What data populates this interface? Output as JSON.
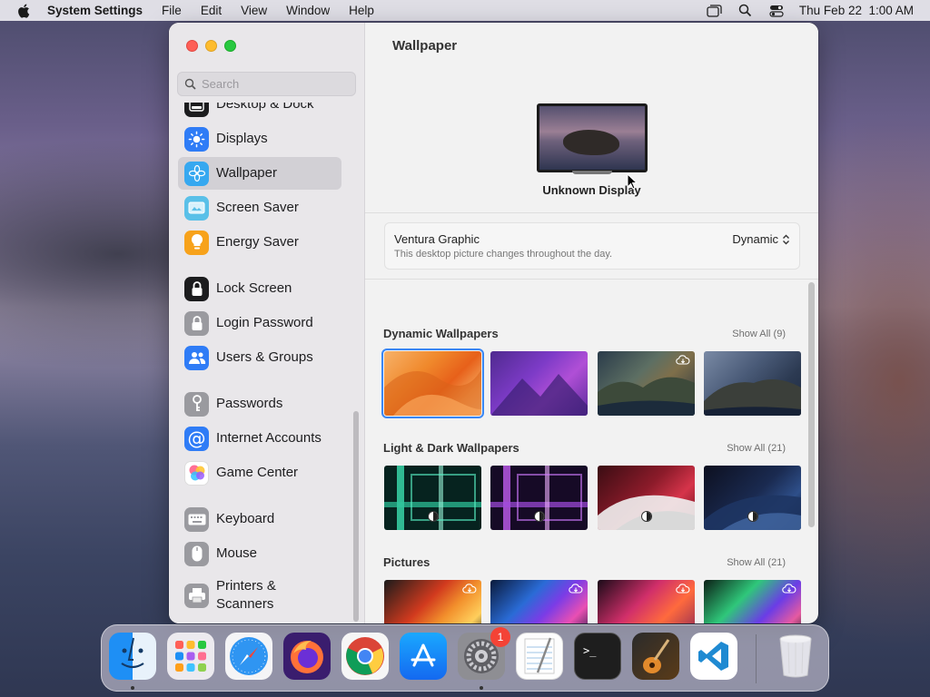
{
  "menubar": {
    "app_name": "System Settings",
    "items": [
      "File",
      "Edit",
      "View",
      "Window",
      "Help"
    ],
    "datetime": "Thu Feb 22  1:00 AM"
  },
  "sidebar": {
    "search_placeholder": "Search",
    "items": [
      {
        "label": "Desktop & Dock",
        "icon": "dock-icon",
        "color": "#1c1c1e"
      },
      {
        "label": "Displays",
        "icon": "sun-icon",
        "color": "#2f7cf6"
      },
      {
        "label": "Wallpaper",
        "icon": "flower-icon",
        "color": "#36a8f0",
        "active": true
      },
      {
        "label": "Screen Saver",
        "icon": "screen-saver-icon",
        "color": "#5ac0e8"
      },
      {
        "label": "Energy Saver",
        "icon": "bulb-icon",
        "color": "#f7a21b"
      },
      {
        "label": "Lock Screen",
        "icon": "lock-icon",
        "color": "#1c1c1e"
      },
      {
        "label": "Login Password",
        "icon": "lock-icon",
        "color": "#8e8e93"
      },
      {
        "label": "Users & Groups",
        "icon": "users-icon",
        "color": "#2f7cf6"
      },
      {
        "label": "Passwords",
        "icon": "key-icon",
        "color": "#8e8e93"
      },
      {
        "label": "Internet Accounts",
        "icon": "at-icon",
        "color": "#2f7cf6"
      },
      {
        "label": "Game Center",
        "icon": "game-center-icon",
        "color": "#ffffff"
      },
      {
        "label": "Keyboard",
        "icon": "keyboard-icon",
        "color": "#8e8e93"
      },
      {
        "label": "Mouse",
        "icon": "mouse-icon",
        "color": "#8e8e93"
      },
      {
        "label": "Printers & Scanners",
        "icon": "printer-icon",
        "color": "#8e8e93"
      }
    ]
  },
  "content": {
    "title": "Wallpaper",
    "display_name": "Unknown Display",
    "current": {
      "name": "Ventura Graphic",
      "description": "This desktop picture changes throughout the day.",
      "mode": "Dynamic"
    },
    "sections": [
      {
        "title": "Dynamic Wallpapers",
        "show_all": "Show All (9)"
      },
      {
        "title": "Light & Dark Wallpapers",
        "show_all": "Show All (21)"
      },
      {
        "title": "Pictures",
        "show_all": "Show All (21)"
      }
    ]
  },
  "dock": {
    "apps": [
      "Finder",
      "Launchpad",
      "Safari",
      "Firefox",
      "Chrome",
      "App Store",
      "System Settings",
      "TextEdit",
      "Terminal",
      "Instruments",
      "Visual Studio Code",
      "Trash"
    ],
    "settings_badge": "1"
  },
  "colors": {
    "accent": "#3a87f5",
    "badge": "#f44336"
  }
}
